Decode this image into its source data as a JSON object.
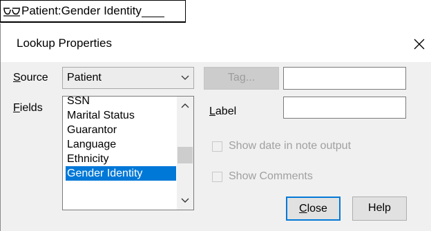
{
  "tag_field": {
    "prefix": "Patient:Gender Identity"
  },
  "dialog": {
    "title": "Lookup Properties",
    "source": {
      "label_accel": "S",
      "label_rest": "ource",
      "value": "Patient"
    },
    "tag_button": {
      "label": "Tag..."
    },
    "tag_text": {
      "value": ""
    },
    "fields": {
      "label_accel": "F",
      "label_rest": "ields",
      "items": [
        "SSN",
        "Marital Status",
        "Guarantor",
        "Language",
        "Ethnicity",
        "Gender Identity"
      ],
      "selected": "Gender Identity"
    },
    "label_field": {
      "label_accel": "L",
      "label_rest": "abel",
      "value": ""
    },
    "show_date": {
      "label": "Show date in note output",
      "checked": false
    },
    "show_comments": {
      "label": "Show Comments",
      "checked": false
    },
    "close_button": {
      "label_accel": "C",
      "label_rest": "lose"
    },
    "help_button": {
      "label": "Help"
    }
  }
}
